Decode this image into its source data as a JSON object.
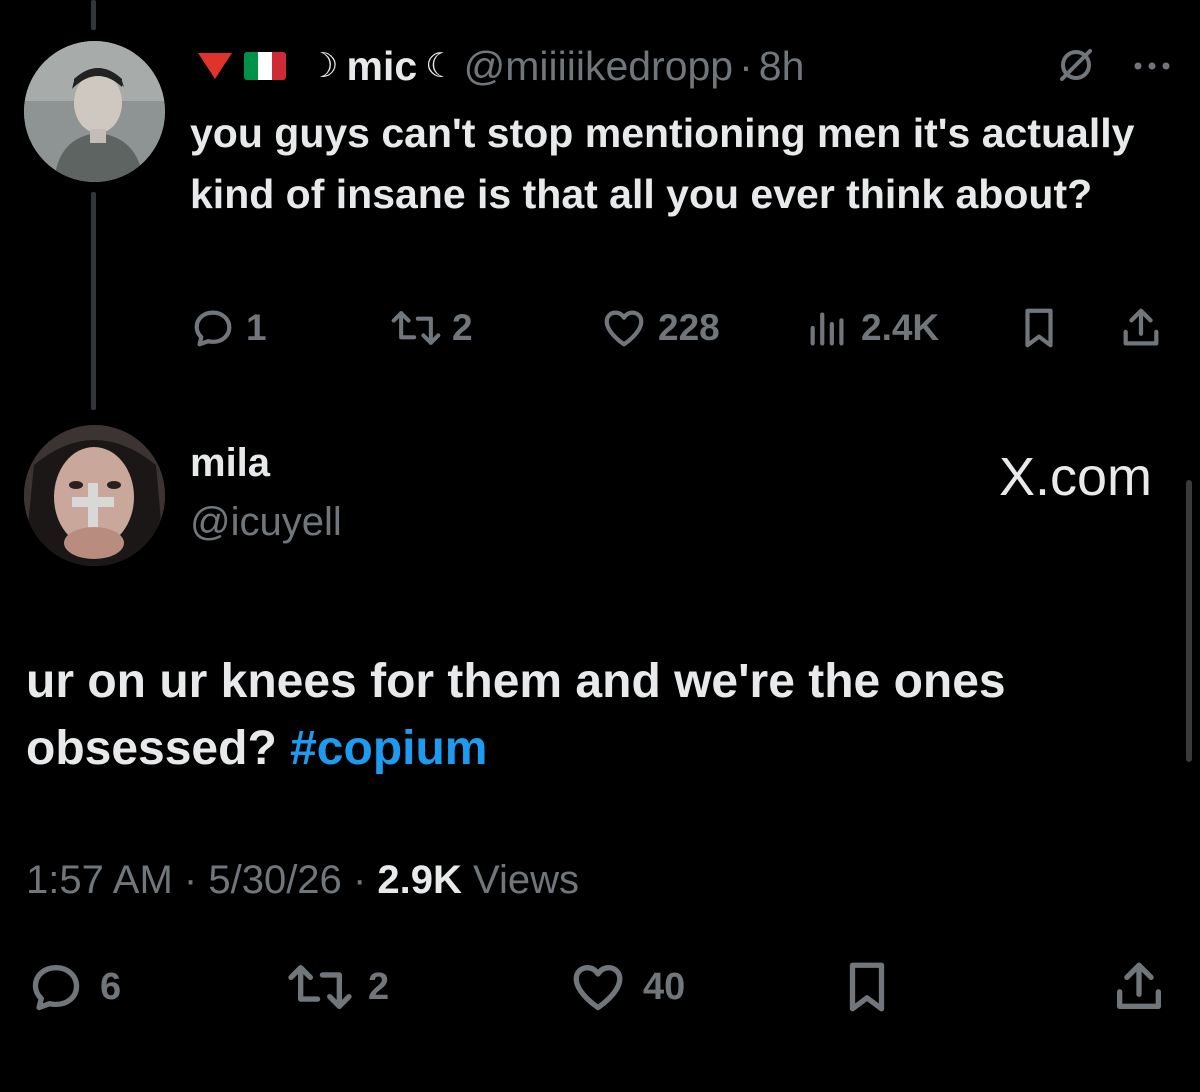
{
  "parent_tweet": {
    "display_name": "mic",
    "moon_left": "☽",
    "moon_right": "☾",
    "handle": "@miiiiikedropp",
    "separator": "·",
    "time_ago": "8h",
    "text": "you guys can't stop mentioning men it's actually kind of insane is that all you ever think about?",
    "flag_colors": [
      "#009246",
      "#ffffff",
      "#ce2b37"
    ],
    "actions": {
      "replies": "1",
      "reposts": "2",
      "likes": "228",
      "views": "2.4K"
    }
  },
  "reply_tweet": {
    "display_name": "mila",
    "handle": "@icuyell",
    "watermark": "X.com",
    "text": "ur on ur knees for them and we're the ones obsessed?",
    "hashtag": "#copium",
    "time": "1:57 AM",
    "date": "5/30/26",
    "separator": "·",
    "views_count": "2.9K",
    "views_label": "Views",
    "actions": {
      "replies": "6",
      "reposts": "2",
      "likes": "40"
    }
  },
  "colors": {
    "background": "#000000",
    "text_primary": "#e7e9ea",
    "text_secondary": "#71767b",
    "accent": "#1d9bf0"
  },
  "icons": [
    "reply-icon",
    "repost-icon",
    "like-icon",
    "views-icon",
    "bookmark-icon",
    "share-icon",
    "grok-icon",
    "more-icon"
  ]
}
